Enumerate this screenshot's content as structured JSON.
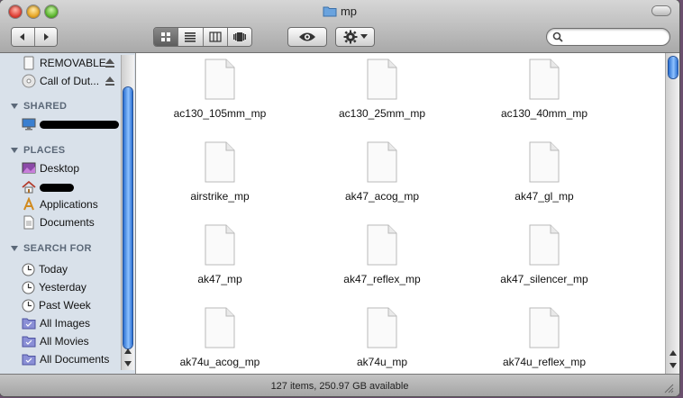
{
  "window": {
    "title": "mp"
  },
  "toolbar": {
    "back_icon": "chevron-left-icon",
    "forward_icon": "chevron-right-icon",
    "views": [
      "icon-view-icon",
      "list-view-icon",
      "column-view-icon",
      "coverflow-view-icon"
    ],
    "active_view": 0,
    "quicklook_icon": "eye-icon",
    "action_icon": "gear-icon",
    "search": {
      "value": "",
      "placeholder": ""
    }
  },
  "sidebar": {
    "devices": [
      {
        "label": "REMOVABLE",
        "icon": "removable-drive-icon",
        "eject": true
      },
      {
        "label": "Call of Dut...",
        "icon": "cd-icon",
        "eject": true
      }
    ],
    "shared_heading": "SHARED",
    "places_heading": "PLACES",
    "places": [
      {
        "label": "Desktop",
        "icon": "desktop-icon"
      },
      {
        "label": "Applications",
        "icon": "applications-icon"
      },
      {
        "label": "Documents",
        "icon": "documents-icon"
      }
    ],
    "search_heading": "SEARCH FOR",
    "searches": [
      {
        "label": "Today",
        "icon": "clock-icon"
      },
      {
        "label": "Yesterday",
        "icon": "clock-icon"
      },
      {
        "label": "Past Week",
        "icon": "clock-icon"
      },
      {
        "label": "All Images",
        "icon": "smart-folder-icon"
      },
      {
        "label": "All Movies",
        "icon": "smart-folder-icon"
      },
      {
        "label": "All Documents",
        "icon": "smart-folder-icon"
      }
    ]
  },
  "files": [
    "ac130_105mm_mp",
    "ac130_25mm_mp",
    "ac130_40mm_mp",
    "airstrike_mp",
    "ak47_acog_mp",
    "ak47_gl_mp",
    "ak47_mp",
    "ak47_reflex_mp",
    "ak47_silencer_mp",
    "ak74u_acog_mp",
    "ak74u_mp",
    "ak74u_reflex_mp"
  ],
  "status": {
    "text": "127 items, 250.97 GB available"
  },
  "colors": {
    "accent": "#2a6fd1",
    "sidebar_bg": "#d9e1ea"
  }
}
